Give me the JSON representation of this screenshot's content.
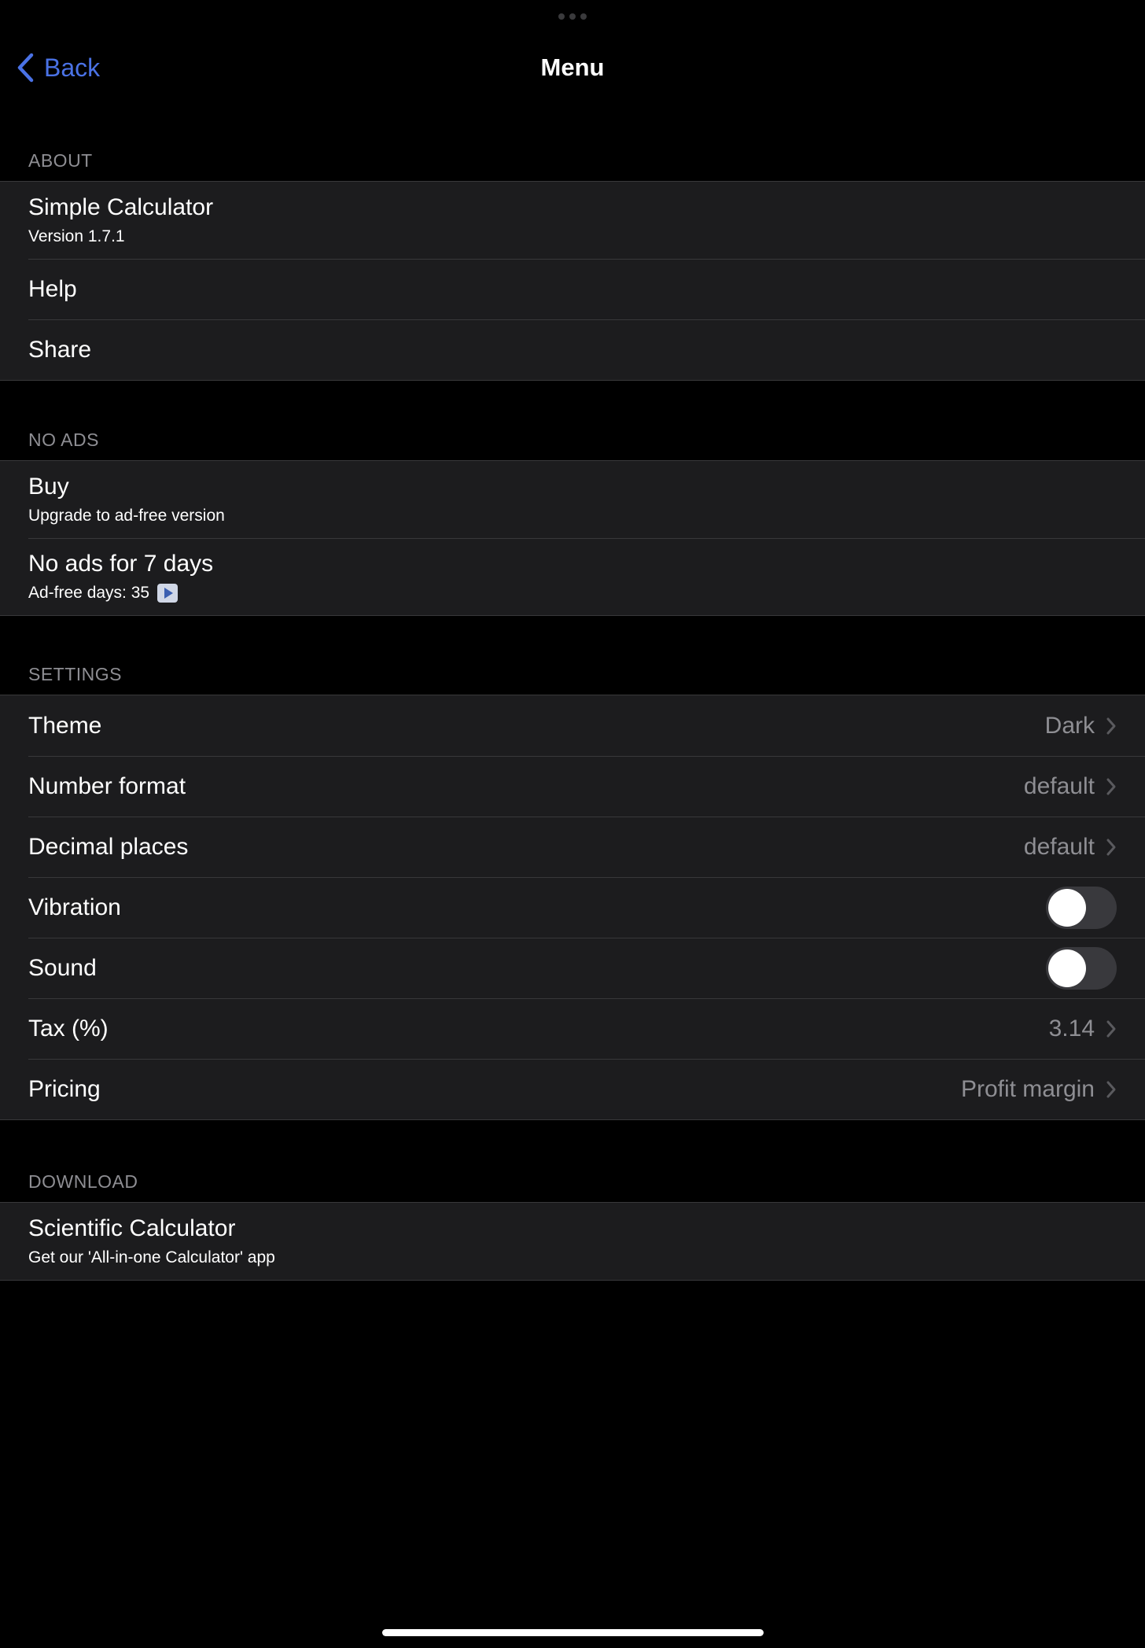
{
  "nav": {
    "back_label": "Back",
    "title": "Menu"
  },
  "sections": {
    "about": {
      "header": "ABOUT",
      "app_name": "Simple Calculator",
      "version": "Version 1.7.1",
      "help": "Help",
      "share": "Share"
    },
    "no_ads": {
      "header": "NO ADS",
      "buy": "Buy",
      "buy_sub": "Upgrade to ad-free version",
      "seven_days": "No ads for 7 days",
      "ad_free_days": "Ad-free days: 35"
    },
    "settings": {
      "header": "SETTINGS",
      "theme_label": "Theme",
      "theme_value": "Dark",
      "number_format_label": "Number format",
      "number_format_value": "default",
      "decimal_places_label": "Decimal places",
      "decimal_places_value": "default",
      "vibration_label": "Vibration",
      "vibration_on": false,
      "sound_label": "Sound",
      "sound_on": false,
      "tax_label": "Tax (%)",
      "tax_value": "3.14",
      "pricing_label": "Pricing",
      "pricing_value": "Profit margin"
    },
    "download": {
      "header": "DOWNLOAD",
      "title": "Scientific Calculator",
      "sub": "Get our 'All-in-one Calculator' app"
    }
  },
  "colors": {
    "accent": "#4a72e6",
    "background": "#000000",
    "cell": "#1c1c1e",
    "secondary_text": "#8e8e93"
  }
}
